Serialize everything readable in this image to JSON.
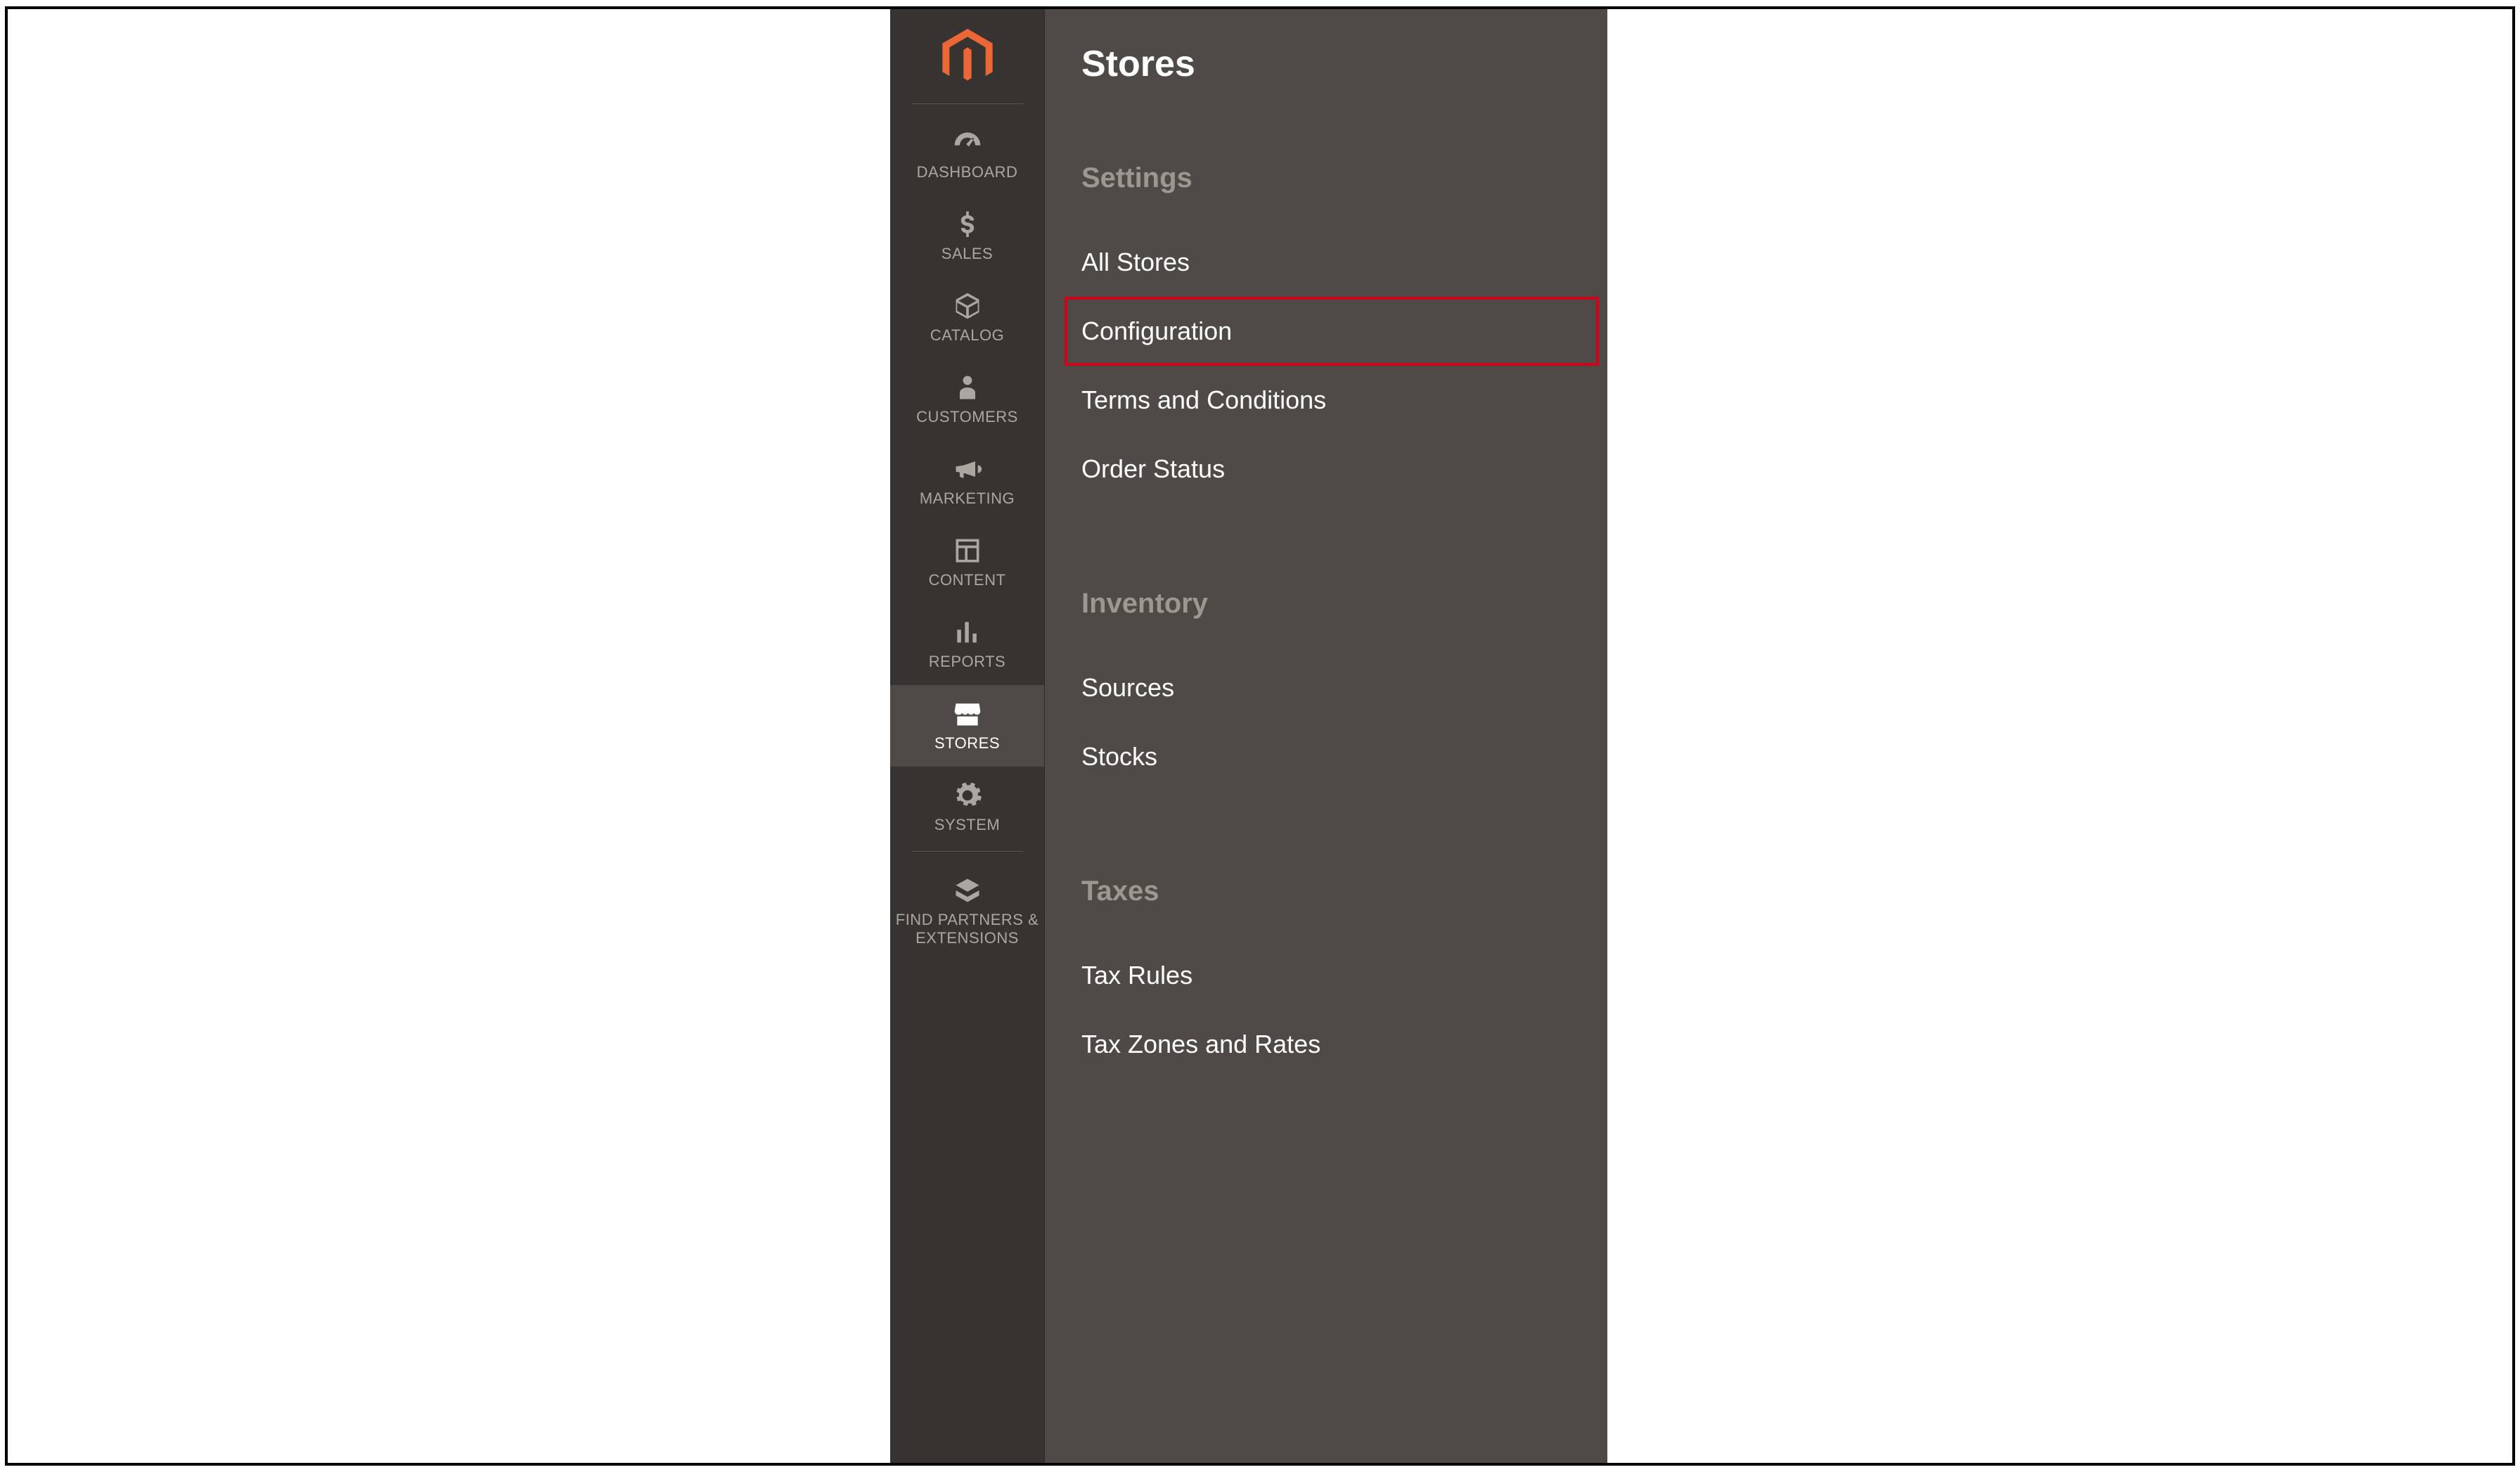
{
  "sidebar": {
    "items": [
      {
        "label": "DASHBOARD"
      },
      {
        "label": "SALES"
      },
      {
        "label": "CATALOG"
      },
      {
        "label": "CUSTOMERS"
      },
      {
        "label": "MARKETING"
      },
      {
        "label": "CONTENT"
      },
      {
        "label": "REPORTS"
      },
      {
        "label": "STORES"
      },
      {
        "label": "SYSTEM"
      },
      {
        "label": "FIND PARTNERS & EXTENSIONS"
      }
    ]
  },
  "flyout": {
    "title": "Stores",
    "sections": [
      {
        "heading": "Settings",
        "items": [
          {
            "label": "All Stores"
          },
          {
            "label": "Configuration",
            "highlighted": true
          },
          {
            "label": "Terms and Conditions"
          },
          {
            "label": "Order Status"
          }
        ]
      },
      {
        "heading": "Inventory",
        "items": [
          {
            "label": "Sources"
          },
          {
            "label": "Stocks"
          }
        ]
      },
      {
        "heading": "Taxes",
        "items": [
          {
            "label": "Tax Rules"
          },
          {
            "label": "Tax Zones and Rates"
          }
        ]
      }
    ]
  }
}
